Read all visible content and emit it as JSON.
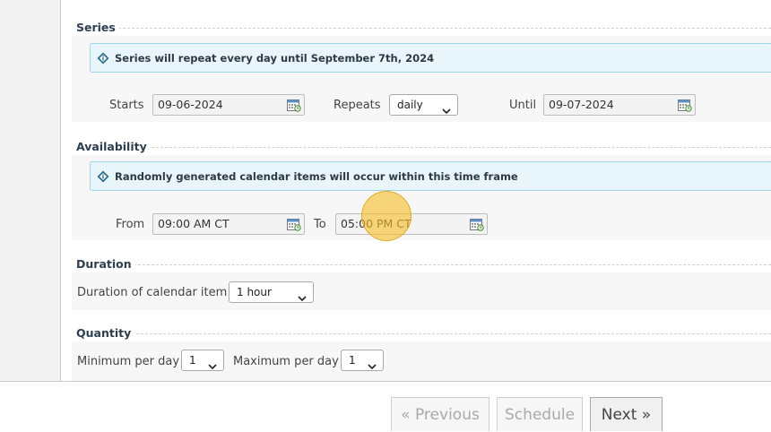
{
  "series": {
    "legend": "Series",
    "info": "Series will repeat every day until September 7th, 2024",
    "starts_label": "Starts",
    "starts_value": "09-06-2024",
    "repeats_label": "Repeats",
    "repeats_value": "daily",
    "until_label": "Until",
    "until_value": "09-07-2024"
  },
  "availability": {
    "legend": "Availability",
    "info": "Randomly generated calendar items will occur within this time frame",
    "from_label": "From",
    "from_value": "09:00 AM CT",
    "to_label": "To",
    "to_value": "05:00 PM CT"
  },
  "duration": {
    "legend": "Duration",
    "label": "Duration of calendar item",
    "value": "1 hour"
  },
  "quantity": {
    "legend": "Quantity",
    "min_label": "Minimum per day",
    "min_value": "1",
    "max_label": "Maximum per day",
    "max_value": "1"
  },
  "footer": {
    "previous_label": "« Previous",
    "schedule_label": "Schedule",
    "next_label": "Next »"
  },
  "icons": {
    "info": "info-diamond-icon",
    "calendar": "calendar-icon",
    "dropdown": "chevron-down-icon"
  },
  "colors": {
    "info_bg": "#e8f6fb",
    "info_border": "#9fd3e6",
    "cursor_highlight": "#f5be28"
  }
}
